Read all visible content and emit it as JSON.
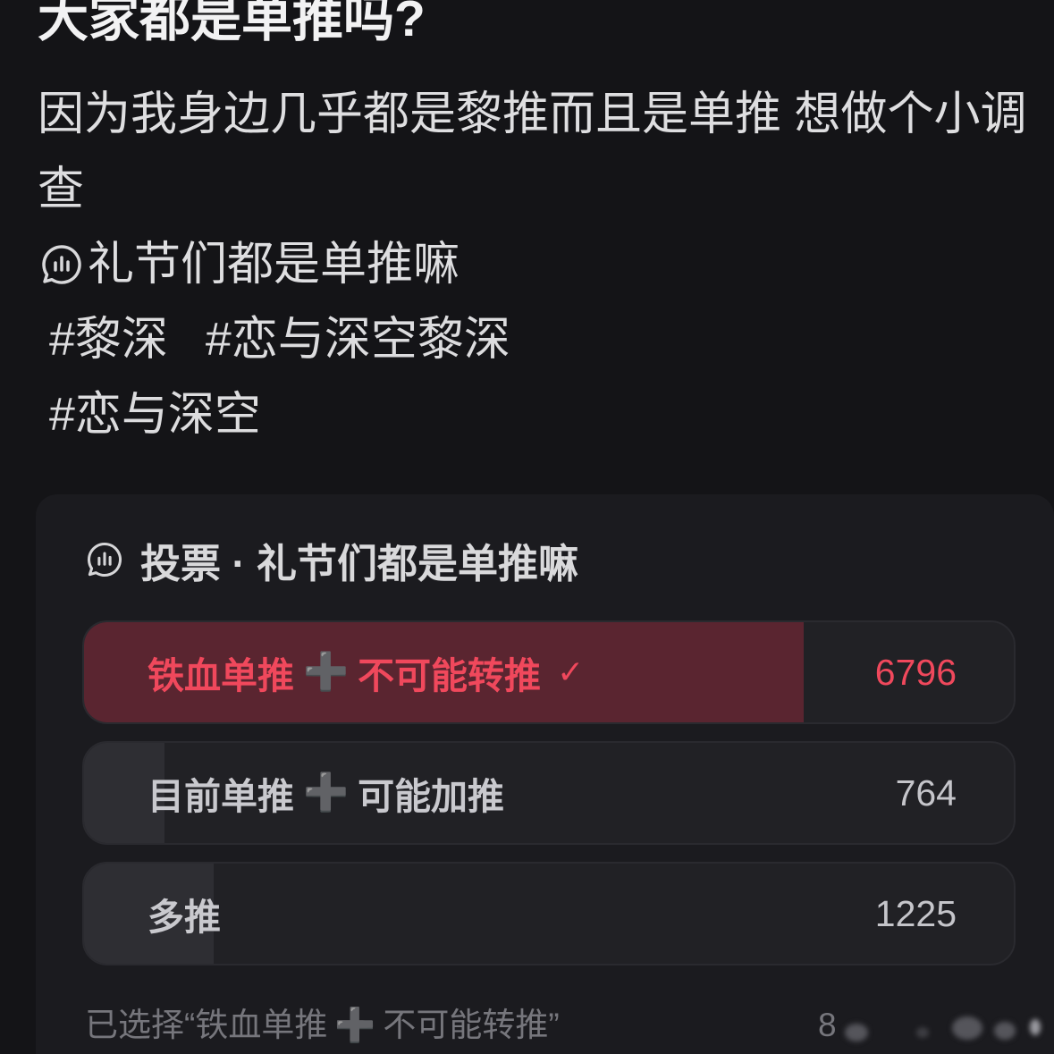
{
  "post": {
    "title": "大家都是单推吗?",
    "body_lines": [
      "因为我身边几乎都是黎推而且是单推 想做个小调",
      "查"
    ],
    "poll_mention": {
      "icon": "poll-icon",
      "text": "礼节们都是单推嘛"
    },
    "hashtags": [
      "#黎深",
      "#恋与深空黎深",
      "#恋与深空"
    ]
  },
  "poll": {
    "icon": "poll-icon",
    "title": "投票 · 礼节们都是单推嘛",
    "options": [
      {
        "label_left": "铁血单推",
        "plus_sign": "➕",
        "label_right": "不可能转推",
        "check": "✓",
        "count": 6796,
        "selected": true,
        "fill_fraction": 0.774
      },
      {
        "label_left": "目前单推",
        "plus_sign": "➕",
        "label_right": "可能加推",
        "count": 764,
        "selected": false,
        "fill_fraction": 0.087
      },
      {
        "label_left": "多推",
        "count": 1225,
        "selected": false,
        "fill_fraction": 0.139
      }
    ],
    "footer": {
      "selected_prefix": "已选择“铁血单推",
      "plus_sign": "➕",
      "selected_suffix": "不可能转推”",
      "participants": "8"
    }
  },
  "colors": {
    "page_bg": "#141417",
    "card_bg": "#1b1b1f",
    "accent": "#f0485c",
    "selected_fill": "#5a2530",
    "option_fill": "#2e2e33"
  }
}
